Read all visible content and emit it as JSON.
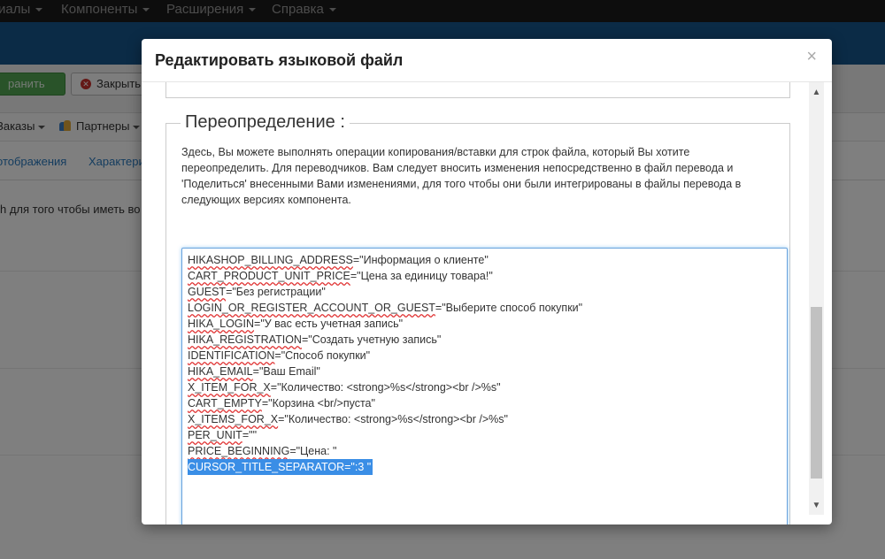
{
  "topbar": {
    "items": [
      {
        "label": "иалы"
      },
      {
        "label": "Компоненты"
      },
      {
        "label": "Расширения"
      },
      {
        "label": "Справка"
      }
    ]
  },
  "toolbar": {
    "save_label": "ранить",
    "close_label": "Закрыть"
  },
  "subnav": {
    "orders_label": "Заказы",
    "partners_label": "Партнеры"
  },
  "tabs": {
    "display_label": "отображения",
    "features_label": "Характери"
  },
  "background_text": "h для того чтобы иметь во",
  "modal": {
    "title": "Редактировать языковой файл",
    "close_symbol": "×",
    "legend": "Переопределение :",
    "description": "Здесь, Вы можете выполнять операции копирования/вставки для строк файла, который Вы хотите переопределить. Для переводчиков. Вам следует вносить изменения непосредственно в файл перевода и 'Поделиться' внесенными Вами изменениями, для того чтобы они были интегрированы в файлы перевода в следующих версиях компонента.",
    "lines": [
      {
        "key": "HIKASHOP_BILLING_ADDRESS",
        "value": "=\"Информация о клиенте\""
      },
      {
        "key": "CART_PRODUCT_UNIT_PRICE",
        "value": "=\"Цена за единицу товара!\""
      },
      {
        "key": "GUEST",
        "value": "=\"Без регистрации\""
      },
      {
        "key": "LOGIN_OR_REGISTER_ACCOUNT_OR_GUEST",
        "value": "=\"Выберите способ покупки\""
      },
      {
        "key": "HIKA_LOGIN",
        "value": "=\"У вас есть учетная запись\""
      },
      {
        "key": "HIKA_REGISTRATION",
        "value": "=\"Создать учетную запись\""
      },
      {
        "key": "IDENTIFICATION",
        "value": "=\"Способ покупки\""
      },
      {
        "key": "HIKA_EMAIL",
        "value": "=\"Ваш Email\""
      },
      {
        "key": "X_ITEM_FOR_X",
        "value": "=\"Количество: <strong>%s</strong><br />%s\""
      },
      {
        "key": "CART_EMPTY",
        "value": "=\"Корзина <br/>пуста\""
      },
      {
        "key": "X_ITEMS_FOR_X",
        "value": "=\"Количество: <strong>%s</strong><br />%s\""
      },
      {
        "key": "PER_UNIT",
        "value": "=\"\""
      },
      {
        "key": "PRICE_BEGINNING",
        "value": "=\"Цена: \""
      },
      {
        "key": "CURSOR_TITLE_SEPARATOR",
        "value": "=\":3 \"",
        "selected": true
      }
    ]
  },
  "icons": {
    "close": "close-icon",
    "up": "scroll-up-arrow-icon",
    "down": "scroll-down-arrow-icon"
  },
  "colors": {
    "topbar": "#1b1b1b",
    "header": "#17568c",
    "save_button": "#52a752",
    "selection": "#3a8ee6",
    "focus_border": "#6aa3dd",
    "link": "#2a7abf"
  }
}
